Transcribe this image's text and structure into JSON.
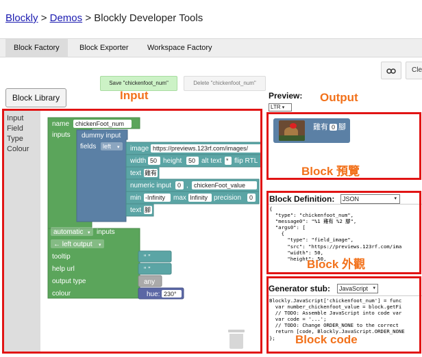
{
  "breadcrumb": {
    "blockly": "Blockly",
    "sep1": ">",
    "demos": "Demos",
    "sep2": ">",
    "page": "Blockly Developer Tools"
  },
  "tabs": [
    "Block Factory",
    "Block Exporter",
    "Workspace Factory"
  ],
  "toolbar": {
    "save_label": "Save \"chickenfoot_num\"",
    "delete_label": "Delete \"chickenfoot_num\"",
    "link_icon": "link-icon",
    "clear_label": "Cle"
  },
  "library_label": "Block Library",
  "toolbox": [
    "Input",
    "Field",
    "Type",
    "Colour"
  ],
  "annotations": {
    "input": "Input",
    "output": "Output",
    "preview": "Block 預覽",
    "appearance": "Block 外觀",
    "code": "Block code"
  },
  "preview": {
    "title": "Preview:",
    "direction": "LTR",
    "block_text": "雞有",
    "block_field": "0",
    "block_suffix": "腳"
  },
  "definition": {
    "title": "Block Definition:",
    "format": "JSON",
    "code": "{\n  \"type\": \"chickenfoot_num\",\n  \"message0\": \"%1 雞有 %2 腳\",\n  \"args0\": [\n    {\n      \"type\": \"field_image\",\n      \"src\": \"https://previews.123rf.com/ima\n      \"width\": 50,\n      \"height\": 50,"
  },
  "generator": {
    "title": "Generator stub:",
    "language": "JavaScript",
    "code": "Blockly.JavaScript['chickenfoot_num'] = func\n  var number_chickenfoot_value = block.getFi\n  // TODO: Assemble JavaScript into code var\n  var code = '...';\n  // TODO: Change ORDER_NONE to the correct\n  return [code, Blockly.JavaScript.ORDER_NONE\n};"
  },
  "workspace": {
    "name_label": "name",
    "name_value": "chickenFoot_num",
    "inputs_label": "inputs",
    "dummy_input": "dummy input",
    "fields_label": "fields",
    "fields_align": "left",
    "image_label": "image",
    "image_url": "https://previews.123rf.com/images/",
    "width_label": "width",
    "width_value": "50",
    "height_label": "height",
    "height_value": "50",
    "alt_label": "alt text",
    "alt_value": "*",
    "flip_label": "flip RTL",
    "text1_label": "text",
    "text1_value": "雞有",
    "numeric_label": "numeric input",
    "numeric_value": "0",
    "numeric_comma": ",",
    "numeric_name": "chickenFoot_value",
    "min_label": "min",
    "min_value": "-Infinity",
    "max_label": "max",
    "max_value": "Infinity",
    "precision_label": "precision",
    "precision_value": "0",
    "text2_label": "text",
    "text2_value": "腳",
    "automatic_label": "automatic",
    "inputs_label2": "inputs",
    "output_label": "← left output",
    "tooltip_label": "tooltip",
    "helpurl_label": "help url",
    "quote_text": "“ ”",
    "output_type_label": "output type",
    "any_label": "any",
    "colour_label": "colour",
    "hue_label": "hue:",
    "hue_value": "230°"
  },
  "colors": {
    "factory_green": "#5ba55b",
    "input_blue": "#5b80a5",
    "field_teal": "#5ba5a5",
    "type_gray": "#aaaaaa",
    "hue_block": "#5b67a5",
    "annotation_red": "#e11414",
    "annotation_orange": "#f2711a"
  }
}
